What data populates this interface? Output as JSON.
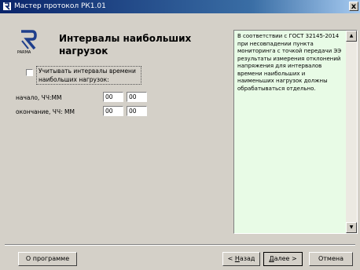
{
  "window": {
    "title": "Мастер протокол РК1.01",
    "close_label": "x"
  },
  "logo": {
    "caption": "PARMA"
  },
  "heading": "Интервалы наибольших нагрузок",
  "checkbox": {
    "label": "Учитывать  интервалы времени наибольших нагрузок:",
    "checked": false
  },
  "fields": {
    "start": {
      "label": "начало, ЧЧ:ММ",
      "hours": "00",
      "minutes": "00"
    },
    "end": {
      "label": "окончание, ЧЧ: ММ",
      "hours": "00",
      "minutes": "00"
    }
  },
  "info": {
    "text": "В соответствии с ГОСТ 32145-2014 при несовпадении пункта мониторинга с точкой передачи ЭЭ результаты измерения отклонений напряжения для интервалов времени наибольших и наименьших нагрузок должны обрабатываться отдельно.",
    "background": "#e8fbe6"
  },
  "buttons": {
    "about": "О программе",
    "back_prefix": "< ",
    "back_mnemonic": "Н",
    "back_rest": "азад",
    "next_mnemonic": "Д",
    "next_rest": "алее >",
    "cancel": "Отмена"
  },
  "colors": {
    "titlebar": "#0a246a",
    "face": "#d4d0c8"
  }
}
